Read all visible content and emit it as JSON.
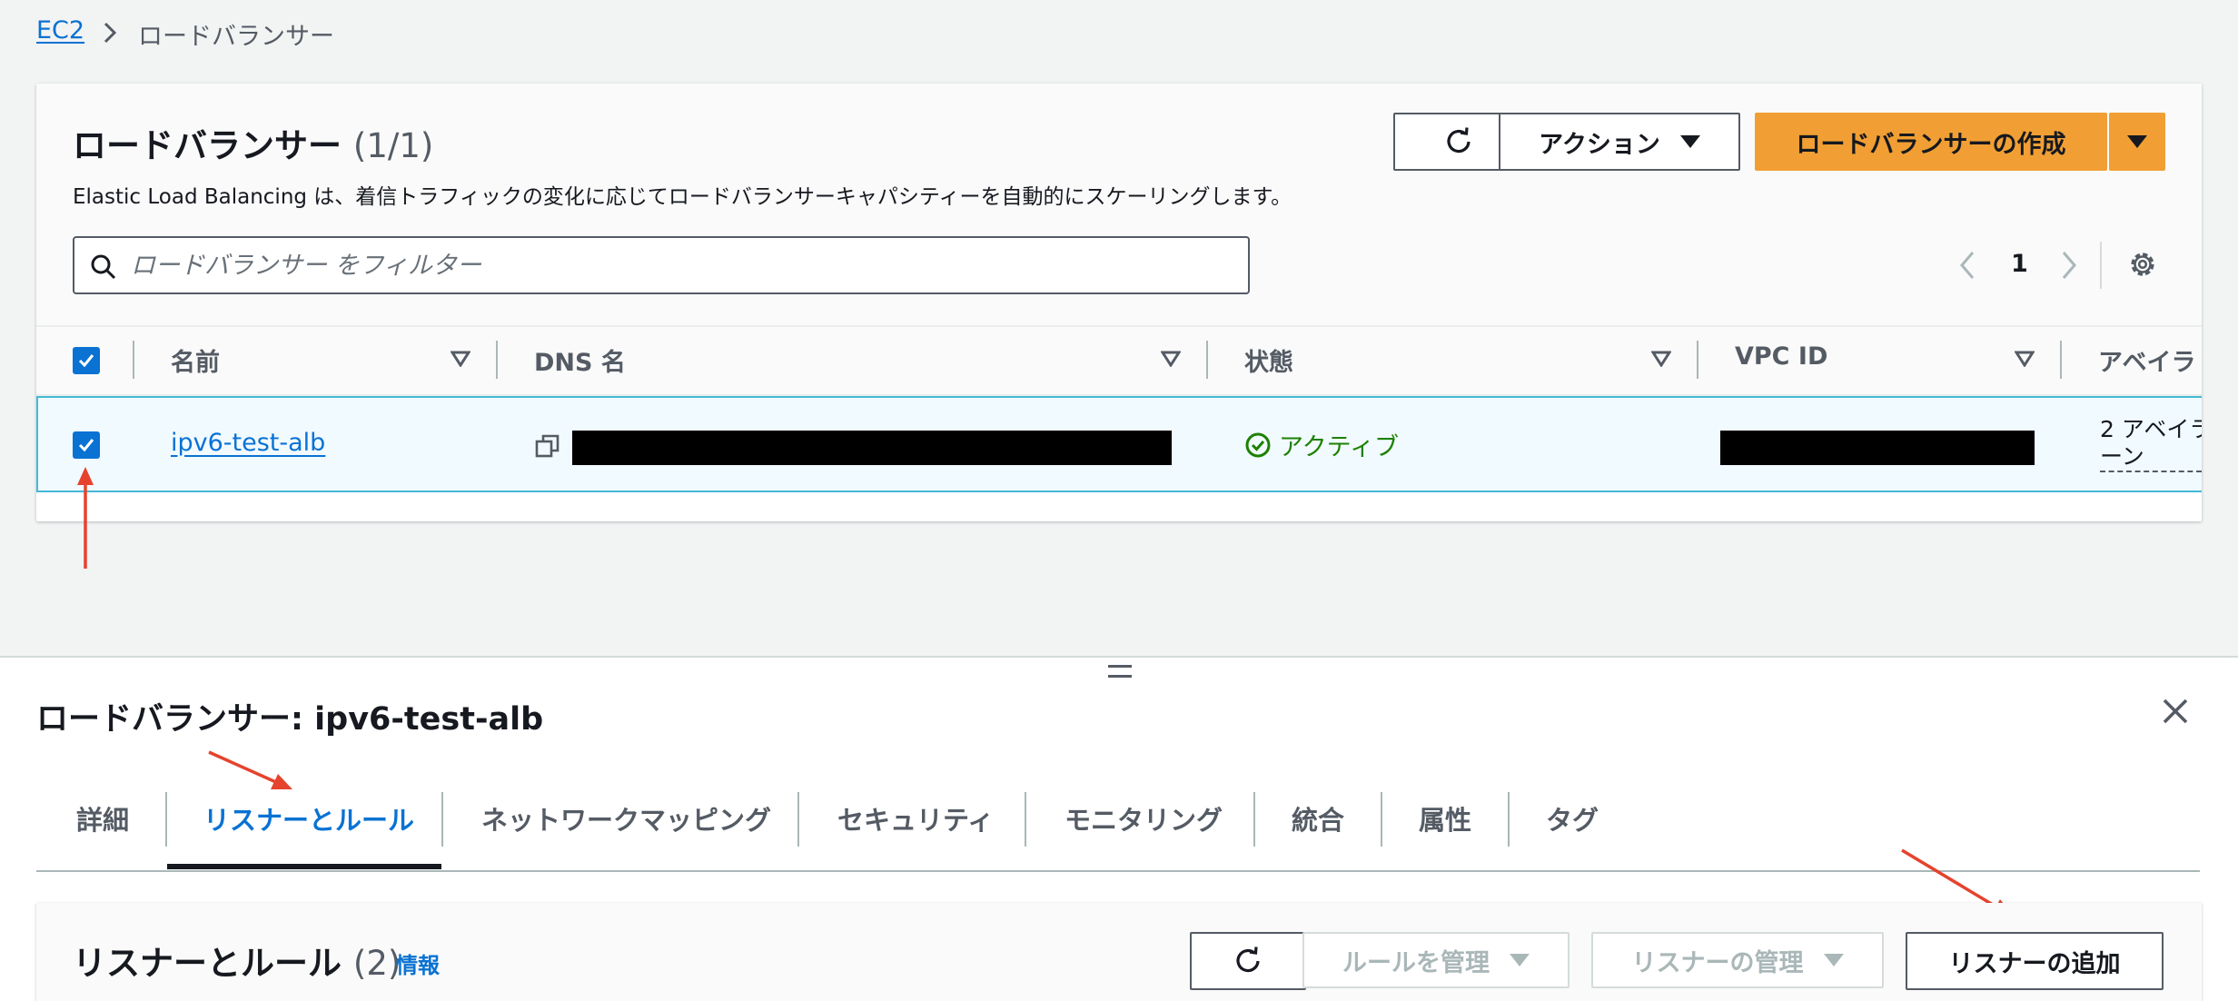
{
  "breadcrumb": {
    "root": "EC2",
    "current": "ロードバランサー"
  },
  "load_balancers": {
    "title": "ロードバランサー",
    "count": "(1/1)",
    "description": "Elastic Load Balancing は、着信トラフィックの変化に応じてロードバランサーキャパシティーを自動的にスケーリングします。",
    "actions_label": "アクション",
    "create_label": "ロードバランサーの作成",
    "filter_placeholder": "ロードバランサー をフィルター",
    "page": "1",
    "columns": [
      "名前",
      "DNS 名",
      "状態",
      "VPC ID",
      "アベイラ"
    ],
    "rows": [
      {
        "name": "ipv6-test-alb",
        "dns": "[redacted]",
        "status": "アクティブ",
        "vpc": "[redacted]",
        "az_line1": "2 アベイラ",
        "az_line2": "ーン"
      }
    ]
  },
  "details": {
    "title": "ロードバランサー: ipv6-test-alb",
    "tabs": [
      "詳細",
      "リスナーとルール",
      "ネットワークマッピング",
      "セキュリティ",
      "モニタリング",
      "統合",
      "属性",
      "タグ"
    ],
    "active_tab": "リスナーとルール",
    "section_title": "リスナーとルール",
    "section_count": "(2)",
    "info_label": "情報",
    "manage_rules_label": "ルールを管理",
    "manage_listeners_label": "リスナーの管理",
    "add_listener_label": "リスナーの追加"
  },
  "colors": {
    "link": "#0972d3",
    "primary": "#f19f34",
    "success": "#1d8102",
    "annotation": "#e5432d"
  },
  "icons": [
    "chevron-right-icon",
    "refresh-icon",
    "caret-down-icon",
    "search-icon",
    "chevron-left-icon",
    "settings-icon",
    "sort-icon",
    "check-icon",
    "copy-icon",
    "status-check-icon",
    "drag-handle-icon",
    "close-icon"
  ]
}
